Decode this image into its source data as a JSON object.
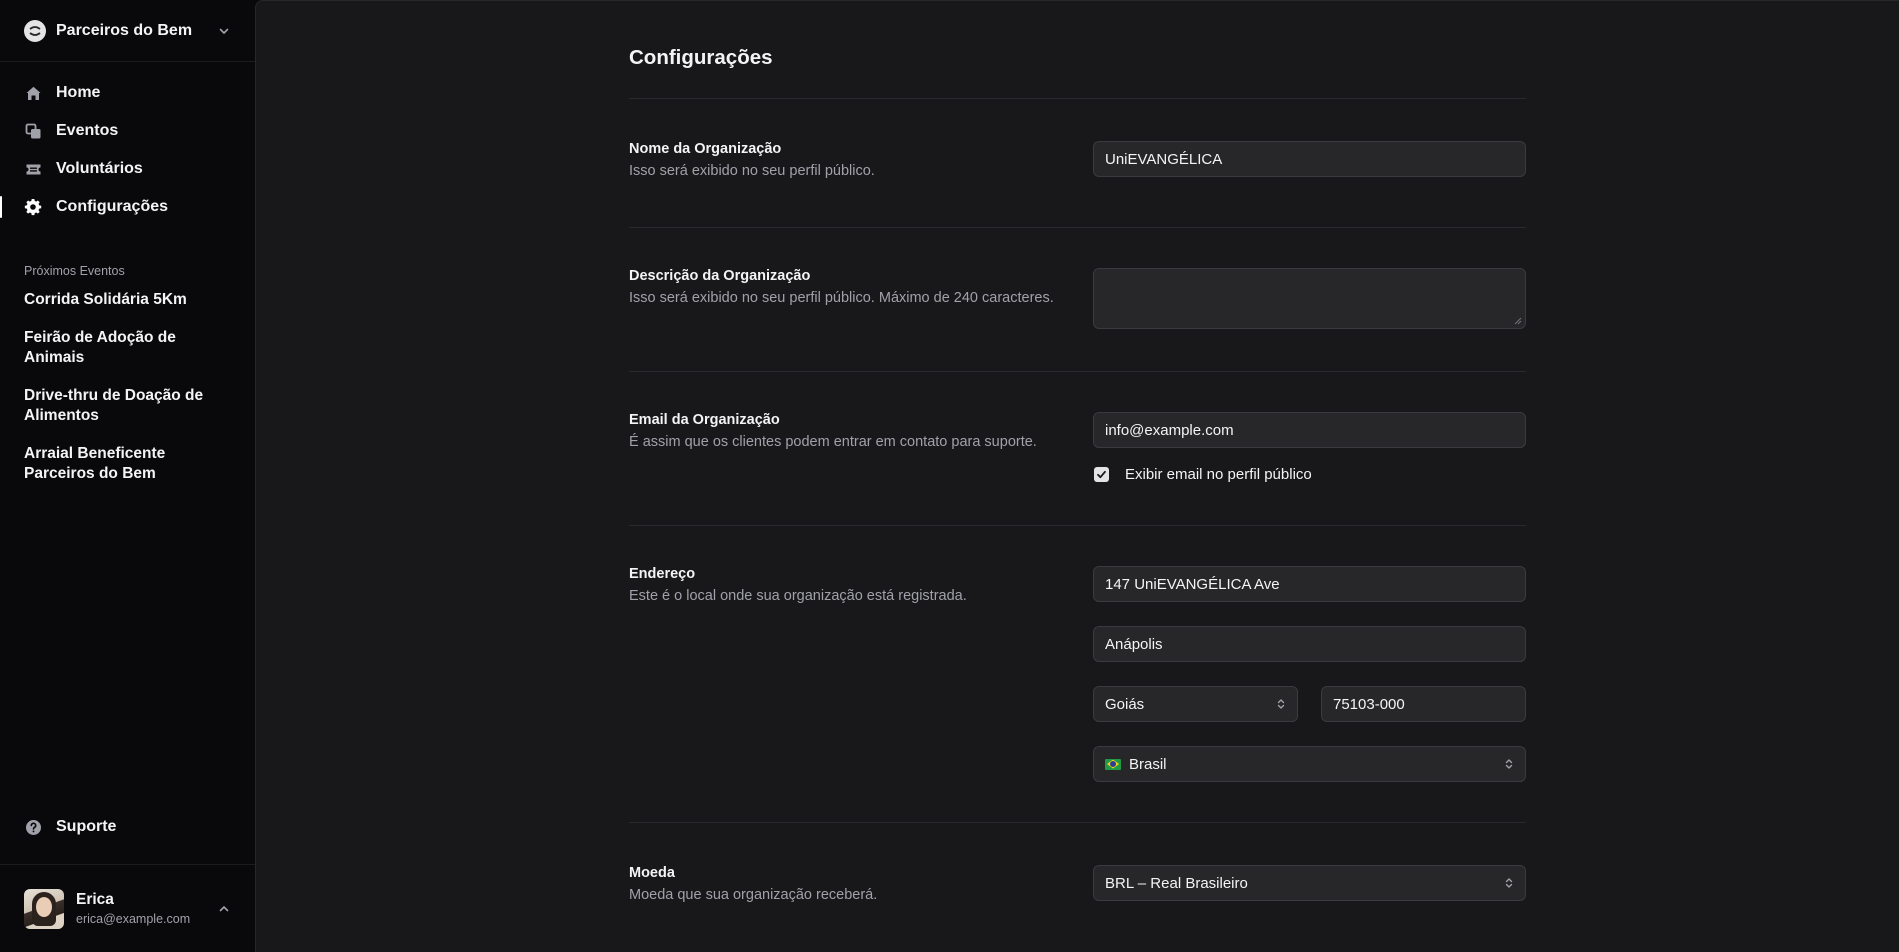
{
  "org": {
    "name": "Parceiros do Bem"
  },
  "nav": {
    "items": [
      {
        "label": "Home",
        "icon": "home-icon"
      },
      {
        "label": "Eventos",
        "icon": "squares-icon"
      },
      {
        "label": "Voluntários",
        "icon": "ticket-icon"
      },
      {
        "label": "Configurações",
        "icon": "gear-icon",
        "active": true
      }
    ]
  },
  "upcoming": {
    "title": "Próximos Eventos",
    "events": [
      "Corrida Solidária 5Km",
      "Feirão de Adoção de Animais",
      "Drive-thru de Doação de Alimentos",
      "Arraial Beneficente Parceiros do Bem"
    ]
  },
  "support": {
    "label": "Suporte"
  },
  "user": {
    "name": "Erica",
    "email": "erica@example.com"
  },
  "page": {
    "title": "Configurações"
  },
  "settings": {
    "org_name": {
      "label": "Nome da Organização",
      "desc": "Isso será exibido no seu perfil público.",
      "value": "UniEVANGÉLICA"
    },
    "org_desc": {
      "label": "Descrição da Organização",
      "desc": "Isso será exibido no seu perfil público. Máximo de 240 caracteres.",
      "value": ""
    },
    "email": {
      "label": "Email da Organização",
      "desc": "É assim que os clientes podem entrar em contato para suporte.",
      "value": "info@example.com",
      "checkbox_label": "Exibir email no perfil público",
      "checked": true
    },
    "address": {
      "label": "Endereço",
      "desc": "Este é o local onde sua organização está registrada.",
      "street": "147 UniEVANGÉLICA Ave",
      "city": "Anápolis",
      "state": "Goiás",
      "zip": "75103-000",
      "country": "Brasil"
    },
    "currency": {
      "label": "Moeda",
      "desc": "Moeda que sua organização receberá.",
      "value": "BRL – Real Brasileiro"
    }
  },
  "colors": {
    "sidebar_bg": "#09090b",
    "main_bg": "#18181b",
    "input_bg": "#27272a",
    "text_primary": "#f4f4f5",
    "text_muted": "#a1a1aa"
  }
}
